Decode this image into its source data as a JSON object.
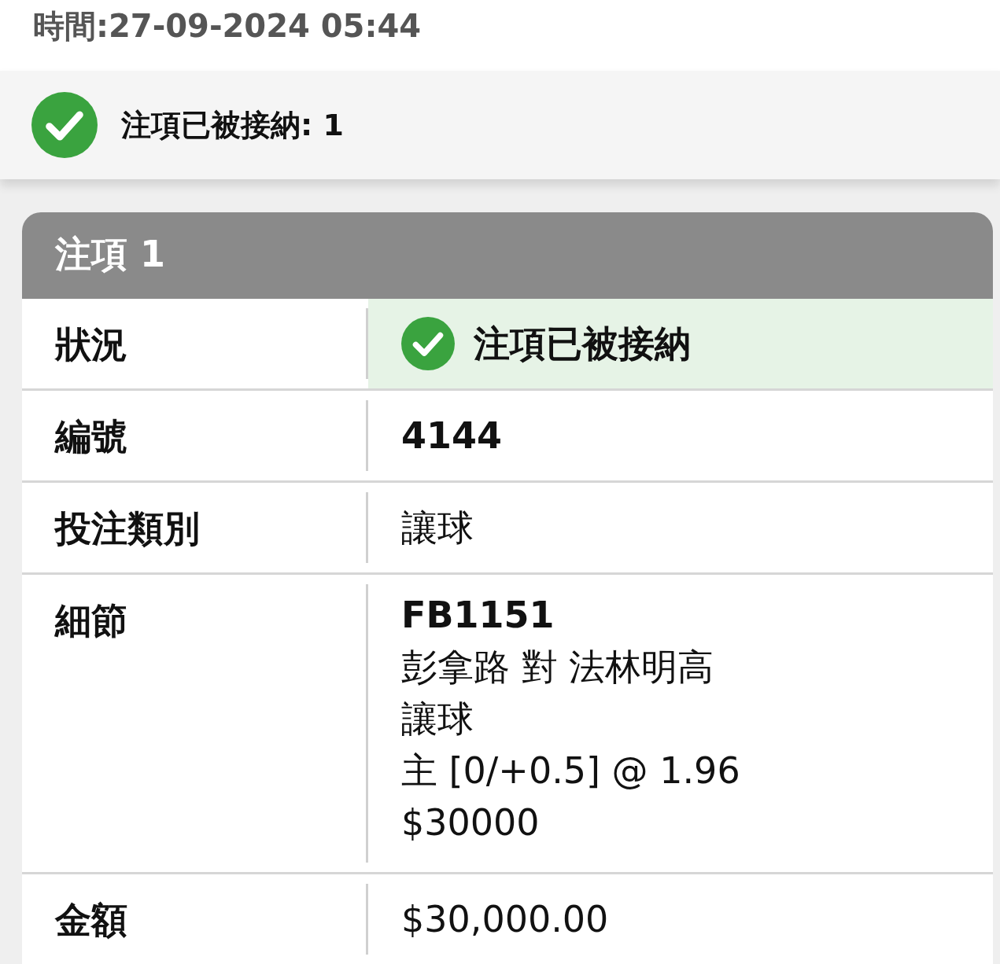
{
  "time": "時間:27-09-2024 05:44",
  "banner": {
    "kind": "success",
    "text": "注項已被接納: 1"
  },
  "bet": {
    "title": "注項 1",
    "rows": [
      {
        "label": "狀況",
        "kind": "status",
        "accepted": true,
        "value": "注項已被接納"
      },
      {
        "label": "編號",
        "kind": "bold",
        "value": "4144"
      },
      {
        "label": "投注類別",
        "kind": "plain",
        "value": "讓球"
      },
      {
        "label": "細節",
        "kind": "lines",
        "lines": [
          "FB1151",
          "彭拿路 對 法林明高",
          "讓球",
          "主 [0/+0.5] @ 1.96",
          "$30000"
        ]
      },
      {
        "label": "金額",
        "kind": "plain",
        "value": "$30,000.00"
      }
    ]
  }
}
